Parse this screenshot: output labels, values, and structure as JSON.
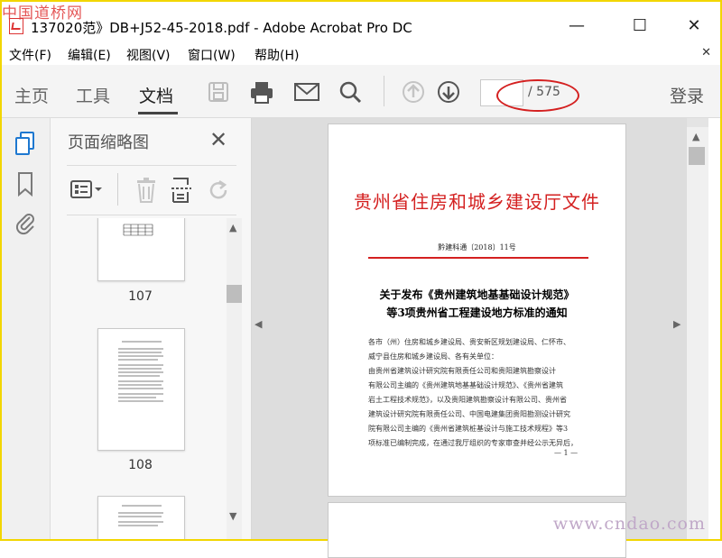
{
  "window": {
    "title": "137020范》DB+J52-45-2018.pdf - Adobe Acrobat Pro DC",
    "minimize": "—",
    "maximize": "☐",
    "close": "✕"
  },
  "watermarks": {
    "top": "中国道桥网",
    "bottom": "www.cndao.com"
  },
  "menu": {
    "items": [
      "文件(F)",
      "编辑(E)",
      "视图(V)",
      "窗口(W)",
      "帮助(H)"
    ],
    "close_doc": "✕"
  },
  "toolbar": {
    "tabs": [
      "主页",
      "工具",
      "文档"
    ],
    "active_tab": "文档",
    "icons": [
      "save-icon",
      "print-icon",
      "email-icon",
      "search-icon",
      "previous-page-icon",
      "next-page-icon"
    ],
    "page_current": "",
    "page_total": "/ 575",
    "login": "登录",
    "colors": {
      "annotation_circle": "#d42020",
      "accent": "#1e78d0"
    }
  },
  "rail": {
    "icons": [
      "page-thumbnails-icon",
      "bookmark-icon",
      "attachment-icon"
    ]
  },
  "thumbnails_panel": {
    "title": "页面缩略图",
    "close": "✕",
    "tool_icons": [
      "options-menu-icon",
      "delete-page-icon",
      "extract-pages-icon",
      "rotate-page-icon"
    ],
    "pages": [
      {
        "label": "107"
      },
      {
        "label": "108"
      }
    ]
  },
  "document": {
    "header_title": "贵州省住房和城乡建设厅文件",
    "doc_number": "黔建科通〔2018〕11号",
    "heading_line1": "关于发布《贵州建筑地基基础设计规范》",
    "heading_line2": "等3项贵州省工程建设地方标准的通知",
    "body_lines": [
      "各市（州）住房和城乡建设局、贵安新区规划建设局、仁怀市、",
      "威宁县住房和城乡建设局、各有关单位：",
      "    由贵州省建筑设计研究院有限责任公司和贵阳建筑勘察设计",
      "有限公司主编的《贵州建筑地基基础设计规范》、《贵州省建筑",
      "岩土工程技术规范》，以及贵阳建筑勘察设计有限公司、贵州省",
      "建筑设计研究院有限责任公司、中国电建集团贵阳勘测设计研究",
      "院有限公司主编的《贵州省建筑桩基设计与施工技术规程》等3",
      "项标准已编制完成，在通过我厅组织的专家审查并经公示无异后，"
    ],
    "page_footer": "— 1 —"
  }
}
